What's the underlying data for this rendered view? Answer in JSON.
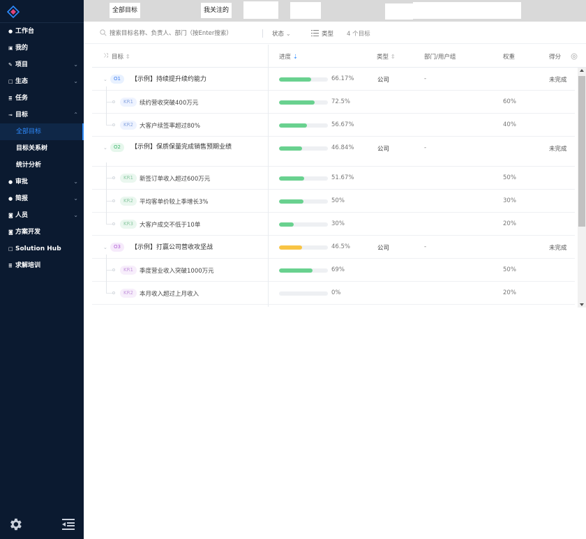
{
  "sidebar": {
    "items": [
      {
        "icon": "dot-icon",
        "label": "工作台"
      },
      {
        "icon": "inbox-icon",
        "label": "我的"
      },
      {
        "icon": "pen-icon",
        "label": "项目",
        "chevron": "down"
      },
      {
        "icon": "square-icon",
        "label": "生态",
        "chevron": "down"
      },
      {
        "icon": "list-icon",
        "label": "任务"
      },
      {
        "icon": "key-icon",
        "label": "目标",
        "chevron": "up"
      }
    ],
    "sub_items": [
      {
        "label": "全部目标",
        "active": true
      },
      {
        "label": "目标关系树"
      },
      {
        "label": "统计分析"
      }
    ],
    "items_after": [
      {
        "icon": "dot-icon",
        "label": "审批",
        "chevron": "down"
      },
      {
        "icon": "dot-icon",
        "label": "简报",
        "chevron": "down"
      },
      {
        "icon": "person-icon",
        "label": "人员",
        "chevron": "down"
      },
      {
        "icon": "person-icon",
        "label": "方案开发"
      },
      {
        "icon": "square-icon",
        "label": "Solution Hub"
      },
      {
        "icon": "list-icon",
        "label": "求解培训"
      }
    ]
  },
  "topbar": {
    "tab_all": "全部目标",
    "tab_follow": "我关注的"
  },
  "filter": {
    "search_placeholder": "搜索目标名称、负责人、部门（按Enter搜索）",
    "status_label": "状态",
    "type_label": "类型",
    "count_label": "4 个目标"
  },
  "table": {
    "headers": {
      "goal": "目标",
      "progress": "进度",
      "type": "类型",
      "dept": "部门/用户组",
      "weight": "权重",
      "score": "得分"
    },
    "objectives": [
      {
        "tag": "O1",
        "title": "【示例】持续提升续约能力",
        "progress_text": "66.17%",
        "progress": 0.6617,
        "color": "#69d18f",
        "type": "公司",
        "dept": "-",
        "score": "未完成",
        "krs": [
          {
            "tag": "KR1",
            "title": "续约营收突破400万元",
            "progress_text": "72.5%",
            "progress": 0.725,
            "weight": "60%"
          },
          {
            "tag": "KR2",
            "title": "大客户续签率超过80%",
            "progress_text": "56.67%",
            "progress": 0.5667,
            "weight": "40%"
          }
        ]
      },
      {
        "tag": "O2",
        "title": "【示例】保质保量完成销售预期业绩",
        "progress_text": "46.84%",
        "progress": 0.4684,
        "color": "#69d18f",
        "type": "公司",
        "dept": "-",
        "score": "未完成",
        "krs": [
          {
            "tag": "KR1",
            "title": "新签订单收入超过600万元",
            "progress_text": "51.67%",
            "progress": 0.5167,
            "weight": "50%"
          },
          {
            "tag": "KR2",
            "title": "平均客单价较上季增长3%",
            "progress_text": "50%",
            "progress": 0.5,
            "weight": "30%"
          },
          {
            "tag": "KR3",
            "title": "大客户成交不低于10单",
            "progress_text": "30%",
            "progress": 0.3,
            "weight": "20%"
          }
        ]
      },
      {
        "tag": "O3",
        "title": "【示例】打赢公司营收攻坚战",
        "progress_text": "46.5%",
        "progress": 0.465,
        "color": "#f8c444",
        "type": "公司",
        "dept": "-",
        "score": "未完成",
        "krs": [
          {
            "tag": "KR1",
            "title": "季度营业收入突破1000万元",
            "progress_text": "69%",
            "progress": 0.69,
            "weight": "50%"
          },
          {
            "tag": "KR2",
            "title": "本月收入超过上月收入",
            "progress_text": "0%",
            "progress": 0,
            "weight": "20%"
          }
        ]
      }
    ]
  }
}
